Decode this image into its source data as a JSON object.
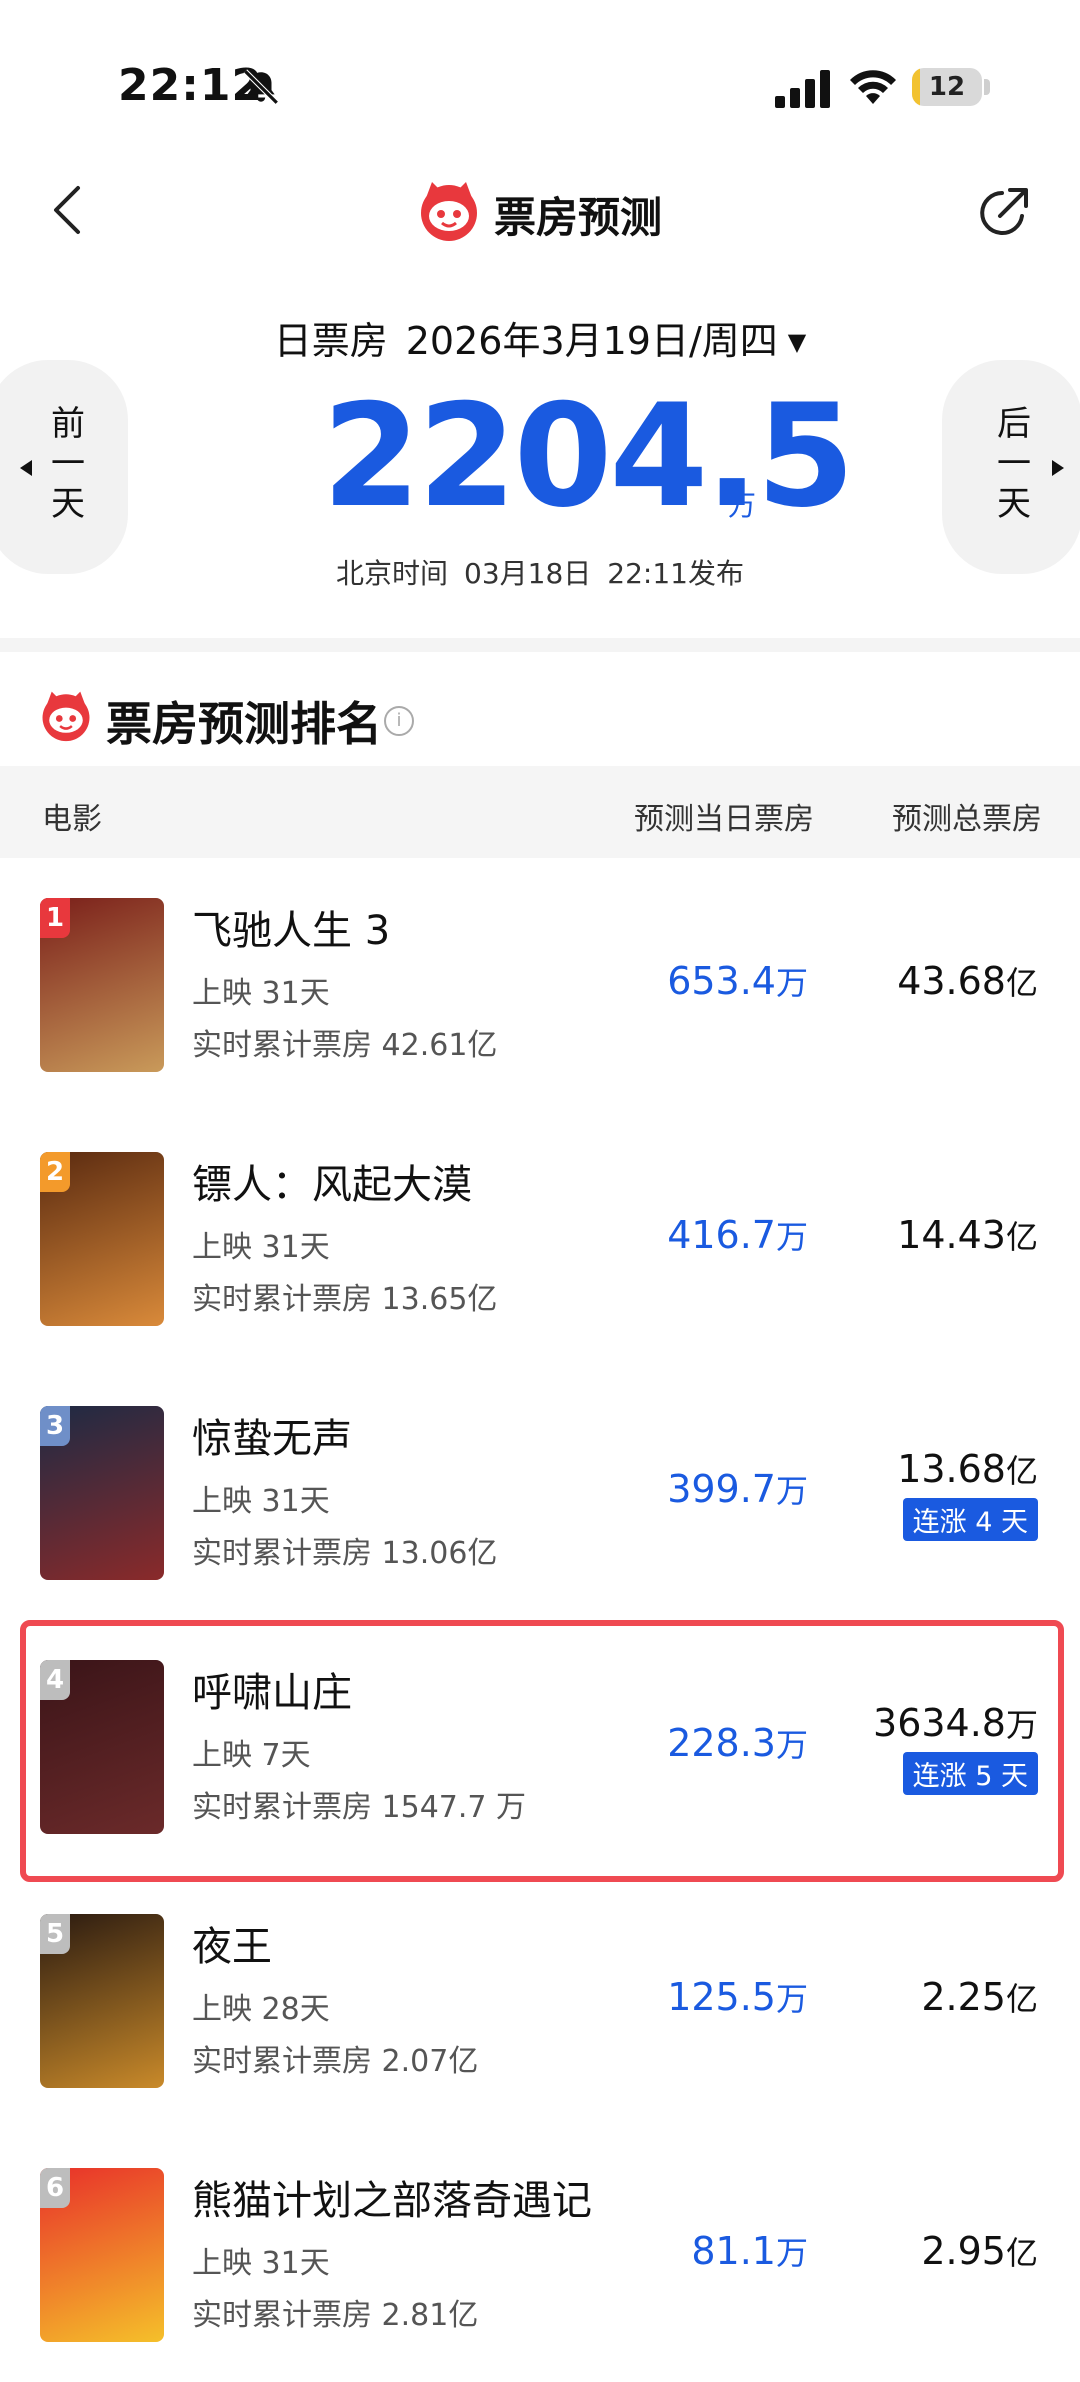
{
  "status_bar": {
    "time": "22:12",
    "battery": "12",
    "battery_level": 0.12
  },
  "nav": {
    "title": "票房预测"
  },
  "summary": {
    "label": "日票房",
    "date": "2026年3月19日/周四",
    "prev": [
      "前",
      "一",
      "天"
    ],
    "next": [
      "后",
      "一",
      "天"
    ],
    "total": "2204.5",
    "unit": "万",
    "publish_prefix": "北京时间",
    "publish_date": "03月18日",
    "publish_time": "22:11发布"
  },
  "ranking": {
    "title": "票房预测排名",
    "columns": {
      "movie": "电影",
      "day": "预测当日票房",
      "total": "预测总票房"
    },
    "rows": [
      {
        "rank": "1",
        "name": "飞驰人生 3",
        "days": "上映 31天",
        "cumulative": "实时累计票房 42.61亿",
        "day_value": "653.4",
        "day_unit": "万",
        "total_value": "43.68",
        "total_unit": "亿",
        "tag": "",
        "badge_color": "#e8383d",
        "poster_colors": [
          "#7a1f1a",
          "#c99a5a"
        ]
      },
      {
        "rank": "2",
        "name": "镖人：风起大漠",
        "days": "上映 31天",
        "cumulative": "实时累计票房 13.65亿",
        "day_value": "416.7",
        "day_unit": "万",
        "total_value": "14.43",
        "total_unit": "亿",
        "tag": "",
        "badge_color": "#f39a2b",
        "poster_colors": [
          "#5a2a10",
          "#d98a3a"
        ]
      },
      {
        "rank": "3",
        "name": "惊蛰无声",
        "days": "上映 31天",
        "cumulative": "实时累计票房 13.06亿",
        "day_value": "399.7",
        "day_unit": "万",
        "total_value": "13.68",
        "total_unit": "亿",
        "tag": "连涨 4 天",
        "badge_color": "#6f8fc8",
        "poster_colors": [
          "#1d2a44",
          "#8a2a2a"
        ]
      },
      {
        "rank": "4",
        "name": "呼啸山庄",
        "days": "上映 7天",
        "cumulative": "实时累计票房 1547.7 万",
        "day_value": "228.3",
        "day_unit": "万",
        "total_value": "3634.8",
        "total_unit": "万",
        "tag": "连涨 5 天",
        "badge_color": "#bdbdbd",
        "poster_colors": [
          "#3a1418",
          "#6b2a2a"
        ]
      },
      {
        "rank": "5",
        "name": "夜王",
        "days": "上映 28天",
        "cumulative": "实时累计票房 2.07亿",
        "day_value": "125.5",
        "day_unit": "万",
        "total_value": "2.25",
        "total_unit": "亿",
        "tag": "",
        "badge_color": "#bdbdbd",
        "poster_colors": [
          "#2a1a10",
          "#c98a2a"
        ]
      },
      {
        "rank": "6",
        "name": "熊猫计划之部落奇遇记",
        "days": "上映 31天",
        "cumulative": "实时累计票房 2.81亿",
        "day_value": "81.1",
        "day_unit": "万",
        "total_value": "2.95",
        "total_unit": "亿",
        "tag": "",
        "badge_color": "#bdbdbd",
        "poster_colors": [
          "#e8302a",
          "#f5c02a"
        ]
      }
    ]
  },
  "colors": {
    "accent": "#1a5ae0",
    "highlight": "#ef4a52",
    "brand": "#e8383d"
  }
}
